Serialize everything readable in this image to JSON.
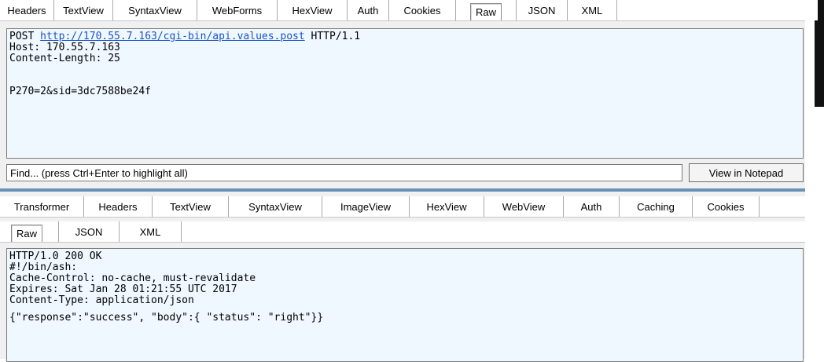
{
  "request": {
    "tabs": [
      "Headers",
      "TextView",
      "SyntaxView",
      "WebForms",
      "HexView",
      "Auth",
      "Cookies",
      "Raw",
      "JSON",
      "XML"
    ],
    "active_tab": "Raw",
    "raw": {
      "method": "POST",
      "url": "http://170.55.7.163/cgi-bin/api.values.post",
      "protocol": "HTTP/1.1",
      "host_line": "Host: 170.55.7.163",
      "length_line": "Content-Length: 25",
      "body": "P270=2&sid=3dc7588be24f"
    },
    "find_placeholder": "Find... (press Ctrl+Enter to highlight all)",
    "notepad_label": "View in Notepad"
  },
  "response": {
    "tabs_row1": [
      "Transformer",
      "Headers",
      "TextView",
      "SyntaxView",
      "ImageView",
      "HexView",
      "WebView",
      "Auth",
      "Caching",
      "Cookies"
    ],
    "tabs_row2": [
      "Raw",
      "JSON",
      "XML"
    ],
    "active_tab": "Raw",
    "raw": {
      "status_line": "HTTP/1.0 200 OK",
      "shebang_line": "#!/bin/ash:",
      "cache_line": "Cache-Control: no-cache, must-revalidate",
      "expires_line": "Expires: Sat Jan 28 01:21:55 UTC 2017",
      "type_line": "Content-Type: application/json",
      "body": "{\"response\":\"success\", \"body\":{ \"status\": \"right\"}}"
    }
  }
}
